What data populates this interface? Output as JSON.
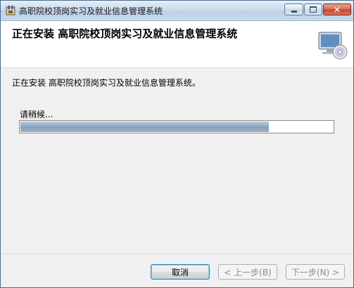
{
  "window": {
    "title": "高职院校顶岗实习及就业信息管理系统"
  },
  "header": {
    "title": "正在安装 高职院校顶岗实习及就业信息管理系统"
  },
  "main": {
    "status_text": "正在安装 高职院校顶岗实习及就业信息管理系统。",
    "progress_label": "请稍候...",
    "progress_fraction": 0.795
  },
  "footer": {
    "cancel_label": "取消",
    "back_label": "< 上一步(B)",
    "next_label": "下一步(N) >"
  },
  "icons": {
    "app": "installer-box-icon",
    "header": "computer-cd-icon"
  },
  "colors": {
    "progress_fill": "#8fa8c2",
    "titlebar": "#c8d9ec"
  }
}
